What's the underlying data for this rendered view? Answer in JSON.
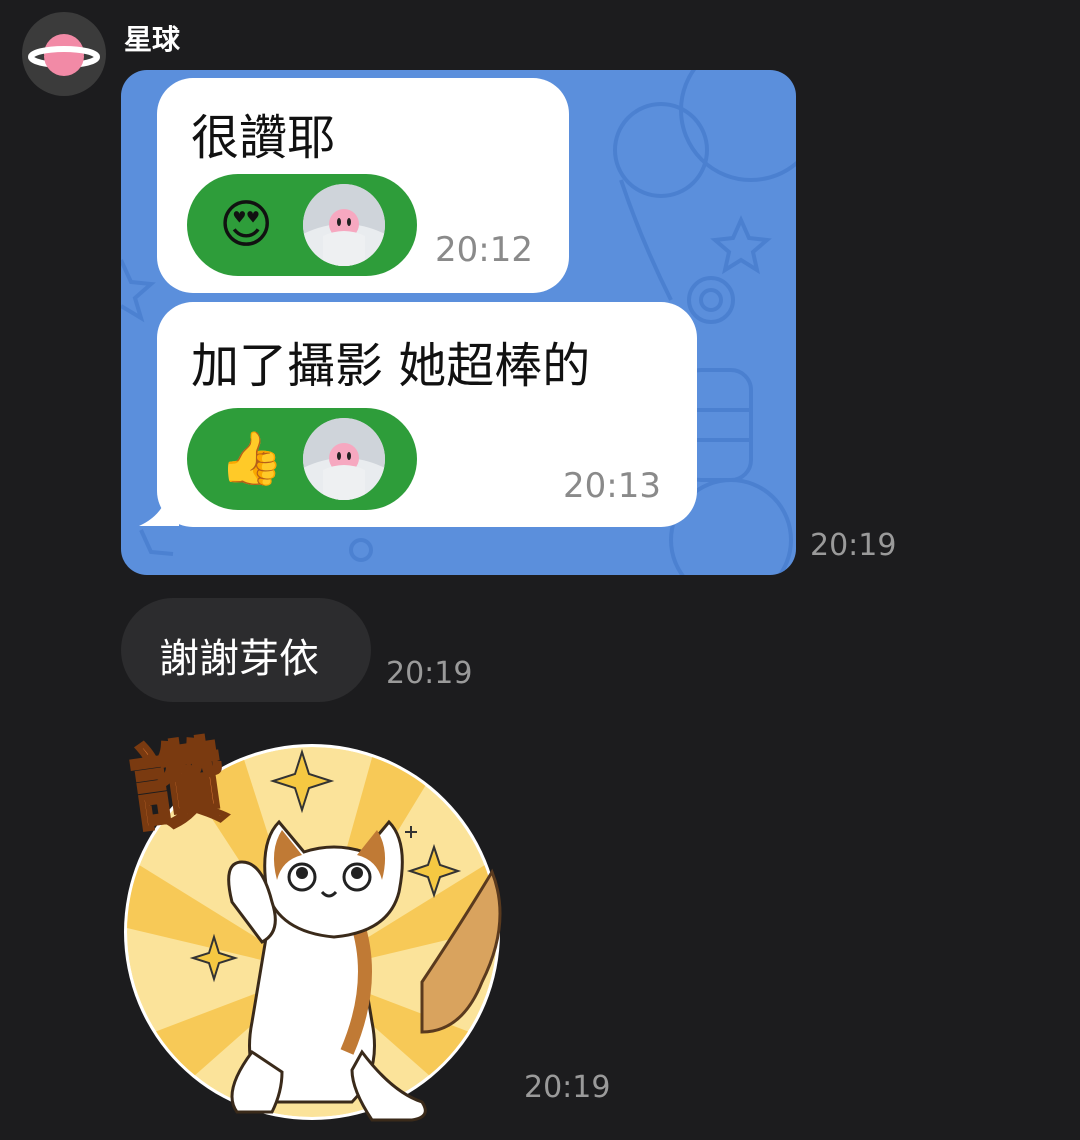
{
  "chat": {
    "sender_name": "星球",
    "sender_avatar_icon": "planet-icon"
  },
  "screenshot": {
    "messages": [
      {
        "text": "很讚耶",
        "reaction_emoji": "😍",
        "time": "20:12"
      },
      {
        "text": "加了攝影 她超棒的",
        "reaction_emoji": "👍",
        "time": "20:13"
      }
    ]
  },
  "messages": {
    "screenshot_time": "20:19",
    "text_message": "謝謝芽依",
    "text_time": "20:19",
    "sticker_text": "讚",
    "sticker_time": "20:19"
  },
  "colors": {
    "background": "#1c1c1e",
    "screenshot_background": "#5b8fdc",
    "reaction_pill": "#2e9d3a",
    "incoming_bubble": "#2c2c2e",
    "time_text": "#9a9a9a"
  }
}
